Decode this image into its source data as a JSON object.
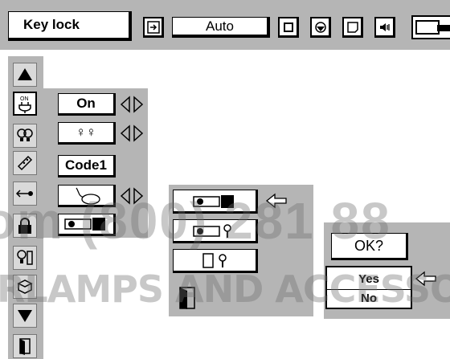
{
  "menu_title": "Key lock",
  "toolbar": {
    "auto_label": "Auto",
    "icons": [
      "input-icon",
      "computer-adjust-icon",
      "image-select-icon",
      "color-adjust-icon",
      "screen-icon",
      "sound-icon",
      "setting-icon"
    ]
  },
  "submenu": {
    "items": [
      {
        "icon": "power-on-icon",
        "value": "On"
      },
      {
        "icon": "lamp-icon",
        "value": "♀♀"
      },
      {
        "icon": "remote-code-icon",
        "value": "Code1"
      },
      {
        "icon": "mouse-icon",
        "value": ""
      },
      {
        "icon": "key-lock-icon",
        "value": ""
      }
    ]
  },
  "lock_options": [
    "projector-only-lock",
    "projector-and-remote-lock",
    "remote-only-lock"
  ],
  "confirm": {
    "question": "OK?",
    "yes": "Yes",
    "no": "No"
  },
  "watermark": {
    "line1": "om (800) 281 88",
    "line2": "RLAMPS AND ACCESSORIES"
  },
  "colors": {
    "panel_gray": "#b5b5b5",
    "field_white": "#ffffff",
    "outline": "#000000"
  }
}
